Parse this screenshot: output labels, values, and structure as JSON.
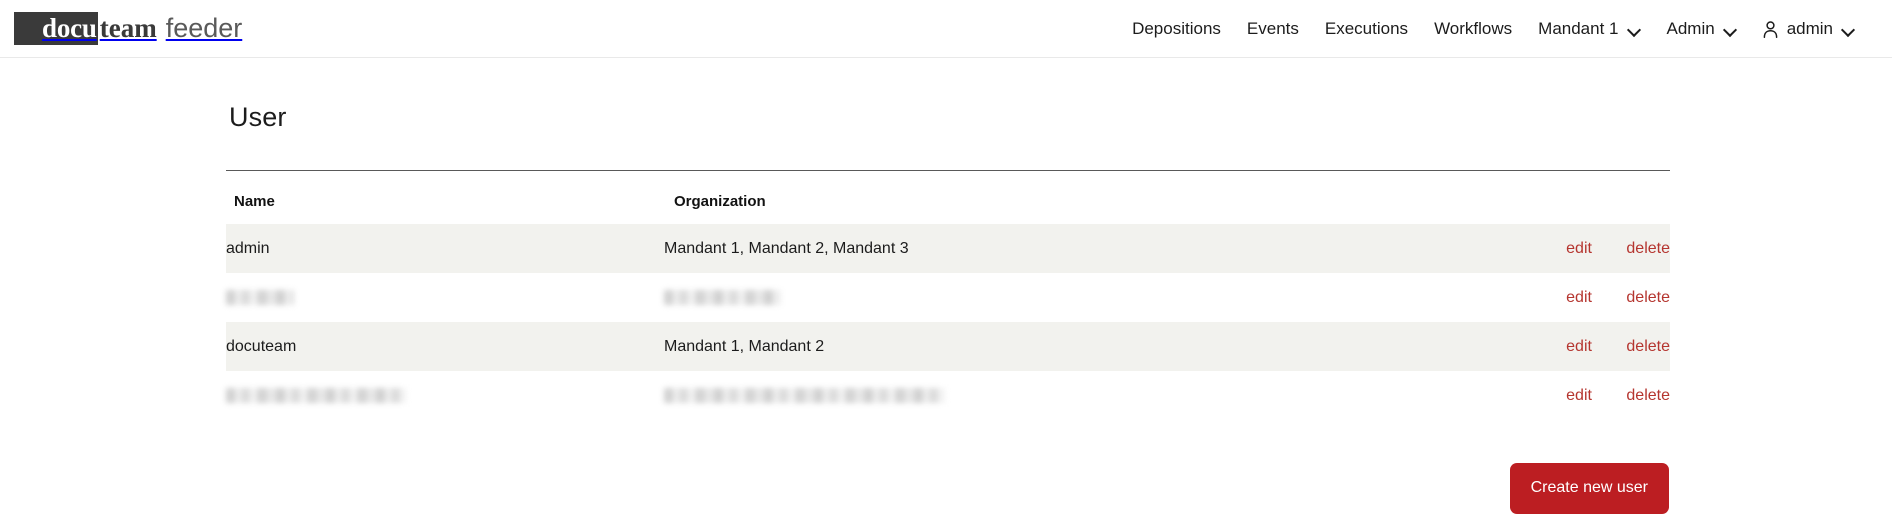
{
  "brand": {
    "mark_text": "docu",
    "mark_suffix": "team",
    "product": "feeder"
  },
  "nav": {
    "items": [
      {
        "label": "Depositions",
        "has_chevron": false,
        "icon": null
      },
      {
        "label": "Events",
        "has_chevron": false,
        "icon": null
      },
      {
        "label": "Executions",
        "has_chevron": false,
        "icon": null
      },
      {
        "label": "Workflows",
        "has_chevron": false,
        "icon": null
      },
      {
        "label": "Mandant 1",
        "has_chevron": true,
        "icon": null
      },
      {
        "label": "Admin",
        "has_chevron": true,
        "icon": null
      },
      {
        "label": "admin",
        "has_chevron": true,
        "icon": "user-icon"
      }
    ]
  },
  "main": {
    "title": "User",
    "table": {
      "columns": {
        "name": "Name",
        "organization": "Organization",
        "actions": ""
      },
      "rows": [
        {
          "name": "admin",
          "organization": "Mandant 1, Mandant 2, Mandant 3",
          "redacted": false,
          "edit_label": "edit",
          "delete_label": "delete"
        },
        {
          "name": "",
          "organization": "",
          "redacted": true,
          "name_width": "w-short",
          "org_width": "w-med",
          "edit_label": "edit",
          "delete_label": "delete"
        },
        {
          "name": "docuteam",
          "organization": "Mandant 1, Mandant 2",
          "redacted": false,
          "edit_label": "edit",
          "delete_label": "delete"
        },
        {
          "name": "",
          "organization": "",
          "redacted": true,
          "name_width": "w-long",
          "org_width": "w-xlong",
          "edit_label": "edit",
          "delete_label": "delete"
        }
      ]
    },
    "create_button": "Create new user"
  },
  "colors": {
    "brand_dark": "#3a3a3a",
    "primary_red": "#bc1e22",
    "link_red": "#b5352f",
    "row_stripe": "#f2f2ee",
    "rule": "#595959"
  }
}
